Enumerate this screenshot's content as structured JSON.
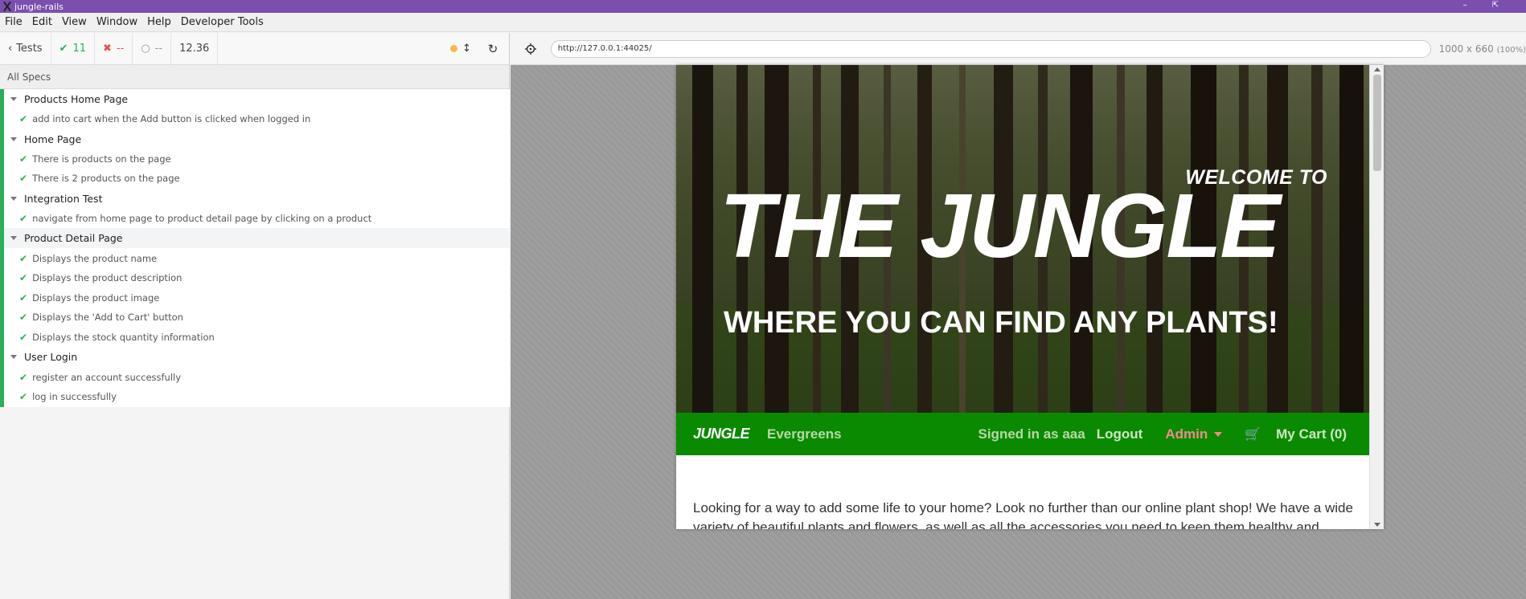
{
  "window": {
    "title": "jungle-rails"
  },
  "menu": [
    "File",
    "Edit",
    "View",
    "Window",
    "Help",
    "Developer Tools"
  ],
  "reporter": {
    "tests_label": "Tests",
    "passed": "11",
    "failed": "--",
    "pending": "--",
    "duration": "12.36",
    "all_specs": "All Specs",
    "suites": [
      {
        "title": "Products Home Page",
        "tests": [
          "add into cart when the Add button is clicked when logged in"
        ]
      },
      {
        "title": "Home Page",
        "tests": [
          "There is products on the page",
          "There is 2 products on the page"
        ]
      },
      {
        "title": "Integration Test",
        "tests": [
          "navigate from home page to product detail page by clicking on a product"
        ]
      },
      {
        "title": "Product Detail Page",
        "tests": [
          "Displays the product name",
          "Displays the product description",
          "Displays the product image",
          "Displays the 'Add to Cart' button",
          "Displays the stock quantity information"
        ]
      },
      {
        "title": "User Login",
        "tests": [
          "register an account successfully",
          "log in successfully"
        ]
      }
    ]
  },
  "aut": {
    "url": "http://127.0.0.1:44025/",
    "viewport": "1000 x 660",
    "scale": "(100%)"
  },
  "site": {
    "welcome": "WELCOME TO",
    "title": "THE JUNGLE",
    "tagline": "WHERE YOU CAN FIND ANY PLANTS!",
    "brand": "JUNGLE",
    "nav_evergreens": "Evergreens",
    "signed_in": "Signed in as aaa",
    "logout": "Logout",
    "admin": "Admin",
    "cart": "My Cart (0)",
    "intro": "Looking for a way to add some life to your home? Look no further than our online plant shop! We have a wide variety of beautiful plants and flowers, as well as all the accessories you need to keep them healthy and happy."
  },
  "colors": {
    "titlebar": "#7b4fb0",
    "pass": "#2aaf5b",
    "fail": "#e94f4f",
    "navbar": "#0a8a00",
    "admin": "#f08a8a"
  }
}
